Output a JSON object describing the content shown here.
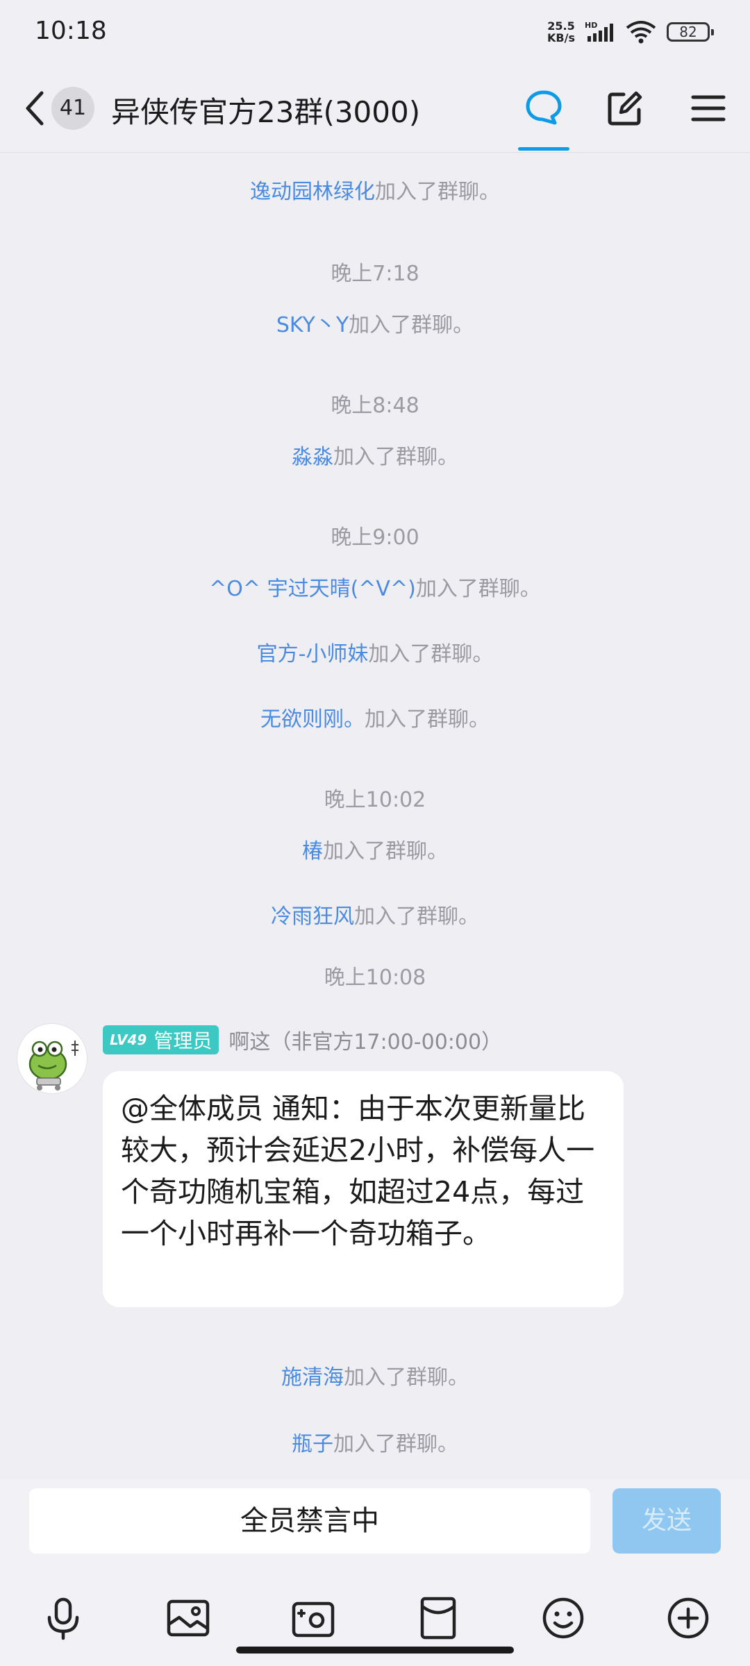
{
  "status_bar": {
    "time": "10:18",
    "speed_value": "25.5",
    "speed_unit": "KB/s",
    "network": "HD",
    "battery": "82"
  },
  "header": {
    "unread_count": "41",
    "title": "异侠传官方23群(3000)",
    "icons": [
      "chevron-left-icon",
      "chat-bubble-icon",
      "edit-icon",
      "menu-icon"
    ],
    "accent_color": "#0f9ae6"
  },
  "messages": [
    {
      "type": "join",
      "who": "逸动园林绿化",
      "text": "加入了群聊。"
    },
    {
      "type": "time",
      "text": "晚上7:18"
    },
    {
      "type": "join",
      "who": "SKY丶Y",
      "text": "加入了群聊。"
    },
    {
      "type": "time",
      "text": "晚上8:48"
    },
    {
      "type": "join",
      "who": "淼淼",
      "text": "加入了群聊。"
    },
    {
      "type": "time",
      "text": "晚上9:00"
    },
    {
      "type": "join",
      "who": "^O^ 宇过天晴(^V^)",
      "text": "加入了群聊。"
    },
    {
      "type": "join",
      "who": "官方-小师妹",
      "text": "加入了群聊。"
    },
    {
      "type": "join",
      "who": "无欲则刚。",
      "text": "加入了群聊。"
    },
    {
      "type": "time",
      "text": "晚上10:02"
    },
    {
      "type": "join",
      "who": "椿",
      "text": "加入了群聊。"
    },
    {
      "type": "join",
      "who": "冷雨狂风",
      "text": "加入了群聊。"
    },
    {
      "type": "time",
      "text": "晚上10:08"
    },
    {
      "type": "message",
      "level": "LV49",
      "role": "管理员",
      "sender": "啊这（非官方17:00-00:00）",
      "text": "@全体成员 通知：由于本次更新量比较大，预计会延迟2小时，补偿每人一个奇功随机宝箱，如超过24点，每过一个小时再补一个奇功箱子。",
      "badge_color": "#3cc9c3"
    },
    {
      "type": "join",
      "who": "施清海",
      "text": "加入了群聊。"
    },
    {
      "type": "join",
      "who": "瓶子",
      "text": "加入了群聊。"
    }
  ],
  "input_bar": {
    "mute_text": "全员禁言中",
    "send_label": "发送",
    "tools": [
      "microphone-icon",
      "image-icon",
      "camera-icon",
      "red-packet-icon",
      "emoji-icon",
      "plus-icon"
    ]
  }
}
